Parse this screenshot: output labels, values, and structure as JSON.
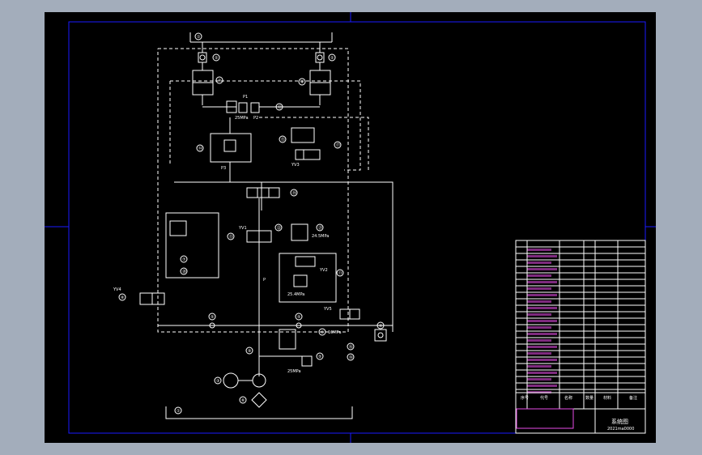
{
  "drawing": {
    "title": "系统图",
    "drawing_no": "2021ma0000",
    "colors": {
      "background_outer": "#a3adbb",
      "sheet": "#000000",
      "frame": "#1a1aff",
      "lines": "#ffffff",
      "title_block_text": "#e64ce6"
    }
  },
  "diagram": {
    "callouts": [
      "①",
      "②",
      "③",
      "④",
      "⑤",
      "⑥",
      "⑦",
      "⑧",
      "⑨",
      "⑩",
      "⑪",
      "⑫",
      "⑬",
      "⑭",
      "⑮",
      "⑯",
      "⑰",
      "⑱",
      "⑲",
      "⑳",
      "㉑",
      "㉒",
      "㉓"
    ],
    "pressure_labels": [
      "25MPa",
      "24.5MPa",
      "25.4MPa",
      "10MPa",
      "25MPa"
    ],
    "port_labels": [
      "P1",
      "P2",
      "P3",
      "P",
      "T"
    ],
    "solenoid_labels": [
      "YV3",
      "YV1",
      "YV2",
      "YV4",
      "YV5"
    ]
  },
  "title_block": {
    "header": [
      "序号",
      "代号",
      "名称",
      "数量",
      "材料",
      "备注"
    ]
  }
}
